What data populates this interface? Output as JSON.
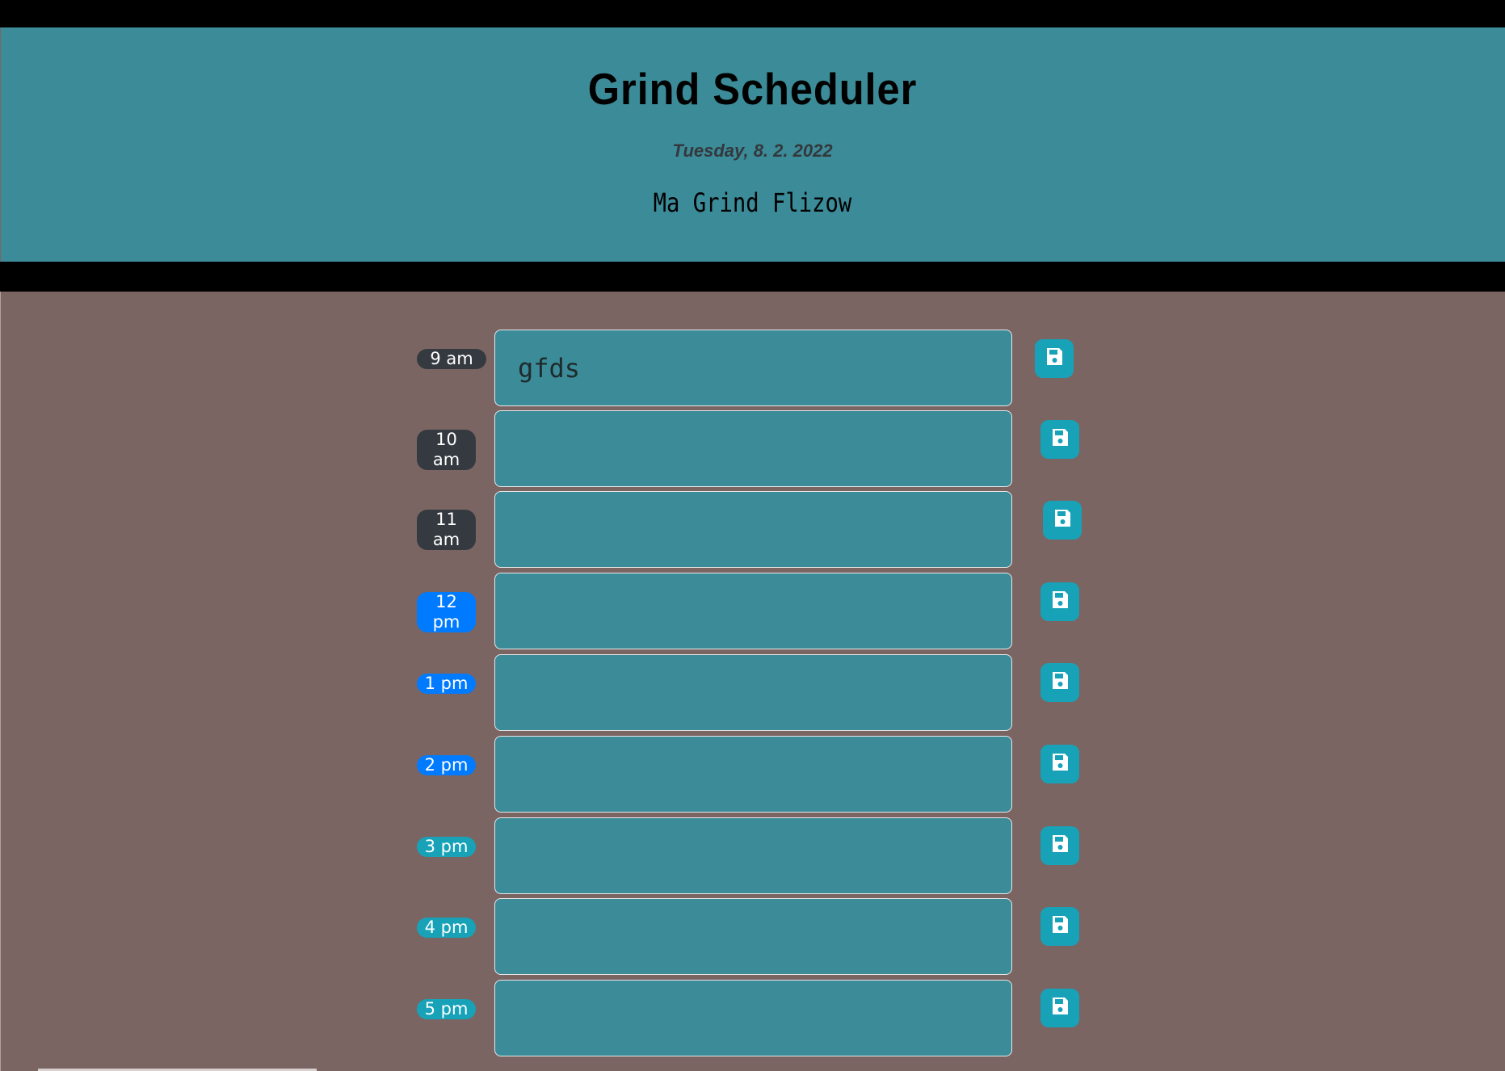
{
  "header": {
    "title": "Grind Scheduler",
    "date": "Tuesday, 8. 2. 2022",
    "subtitle": "Ma Grind Flizow"
  },
  "colors": {
    "header_bg": "#3b8b98",
    "page_bg": "#7a6563",
    "past": "#343a40",
    "present": "#007bff",
    "future": "#17a2b8",
    "save_button": "#17a2b8"
  },
  "rows": [
    {
      "hour_line1": "9 am",
      "hour_line2": "",
      "status": "past",
      "text": "gfds",
      "save_icon": "floppy-disk-icon"
    },
    {
      "hour_line1": "10",
      "hour_line2": "am",
      "status": "past",
      "text": "",
      "save_icon": "floppy-disk-icon"
    },
    {
      "hour_line1": "11",
      "hour_line2": "am",
      "status": "past",
      "text": "",
      "save_icon": "floppy-disk-icon"
    },
    {
      "hour_line1": "12",
      "hour_line2": "pm",
      "status": "present",
      "text": "",
      "save_icon": "floppy-disk-icon"
    },
    {
      "hour_line1": "1 pm",
      "hour_line2": "",
      "status": "present",
      "text": "",
      "save_icon": "floppy-disk-icon"
    },
    {
      "hour_line1": "2 pm",
      "hour_line2": "",
      "status": "present",
      "text": "",
      "save_icon": "floppy-disk-icon"
    },
    {
      "hour_line1": "3 pm",
      "hour_line2": "",
      "status": "future",
      "text": "",
      "save_icon": "floppy-disk-icon"
    },
    {
      "hour_line1": "4 pm",
      "hour_line2": "",
      "status": "future",
      "text": "",
      "save_icon": "floppy-disk-icon"
    },
    {
      "hour_line1": "5 pm",
      "hour_line2": "",
      "status": "future",
      "text": "",
      "save_icon": "floppy-disk-icon"
    }
  ]
}
